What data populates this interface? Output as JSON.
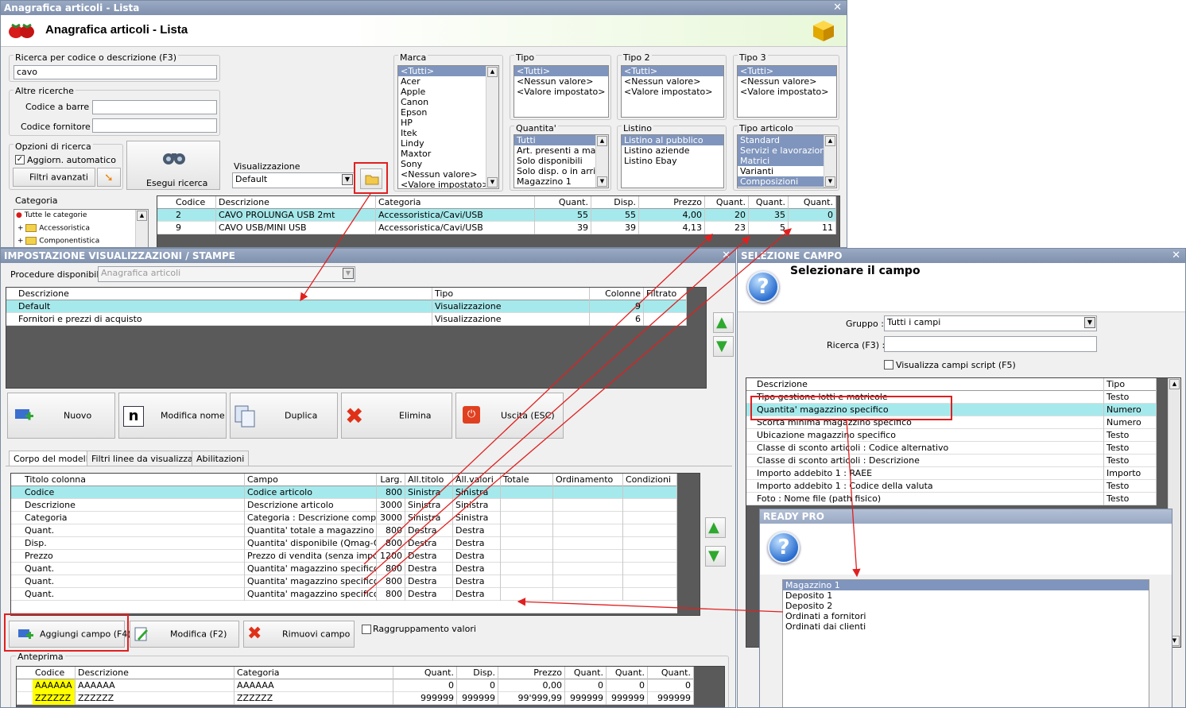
{
  "main_window": {
    "title": "Anagrafica articoli  - Lista",
    "header_title": "Anagrafica articoli  - Lista",
    "search": {
      "label": "Ricerca per codice o descrizione (F3)",
      "value": "cavo"
    },
    "altre_ricerche": {
      "label": "Altre ricerche",
      "barcode_label": "Codice a barre :",
      "supplier_code_label": "Codice fornitore :"
    },
    "opzioni": {
      "label": "Opzioni di ricerca",
      "auto_update": "Aggiorn. automatico",
      "auto_update_checked": true,
      "advanced_filters": "Filtri avanzati"
    },
    "esegui": "Esegui ricerca",
    "visualizzazione": {
      "label": "Visualizzazione",
      "value": "Default"
    },
    "categoria": {
      "label": "Categoria",
      "items": [
        "Tutte le categorie",
        "Accessoristica",
        "Componentistica"
      ]
    },
    "marca": {
      "label": "Marca",
      "items": [
        "<Tutti>",
        "Acer",
        "Apple",
        "Canon",
        "Epson",
        "HP",
        "Itek",
        "Lindy",
        "Maxtor",
        "Sony",
        "<Nessun valore>",
        "<Valore impostato>"
      ]
    },
    "tipo": {
      "label": "Tipo",
      "items": [
        "<Tutti>",
        "<Nessun valore>",
        "<Valore impostato>"
      ]
    },
    "tipo2": {
      "label": "Tipo 2",
      "items": [
        "<Tutti>",
        "<Nessun valore>",
        "<Valore impostato>"
      ]
    },
    "tipo3": {
      "label": "Tipo 3",
      "items": [
        "<Tutti>",
        "<Nessun valore>",
        "<Valore impostato>"
      ]
    },
    "quantita": {
      "label": "Quantita'",
      "items": [
        "Tutti",
        "Art. presenti a magazzino",
        "Solo disponibili",
        "Solo disp. o in arrivo",
        "Magazzino 1"
      ]
    },
    "listino": {
      "label": "Listino",
      "items": [
        "Listino al pubblico",
        "Listino aziende",
        "Listino Ebay"
      ]
    },
    "tipo_articolo": {
      "label": "Tipo articolo",
      "items": [
        "Standard",
        "Servizi e lavorazioni",
        "Matrici",
        "Varianti",
        "Composizioni"
      ]
    },
    "grid": {
      "headers": [
        "Codice",
        "Descrizione",
        "Categoria",
        "Quant.",
        "Disp.",
        "Prezzo",
        "Quant.",
        "Quant.",
        "Quant."
      ],
      "rows": [
        [
          "2",
          "CAVO PROLUNGA USB 2mt",
          "Accessoristica/Cavi/USB",
          "55",
          "55",
          "4,00",
          "20",
          "35",
          "0"
        ],
        [
          "9",
          "CAVO USB/MINI USB",
          "Accessoristica/Cavi/USB",
          "39",
          "39",
          "4,13",
          "23",
          "5",
          "11"
        ]
      ]
    }
  },
  "settings_window": {
    "title": "IMPOSTAZIONE VISUALIZZAZIONI / STAMPE",
    "procedure": {
      "label": "Procedure disponibili :",
      "value": "Anagrafica articoli"
    },
    "views_grid": {
      "headers": [
        "Descrizione",
        "Tipo",
        "Colonne",
        "Filtrato"
      ],
      "rows": [
        [
          "Default",
          "Visualizzazione",
          "9",
          ""
        ],
        [
          "Fornitori e prezzi di acquisto",
          "Visualizzazione",
          "6",
          ""
        ]
      ]
    },
    "buttons": {
      "nuovo": "Nuovo",
      "modifica_nome": "Modifica nome",
      "duplica": "Duplica",
      "elimina": "Elimina",
      "uscita": "Uscita (ESC)"
    },
    "tabs": [
      "Corpo del modello",
      "Filtri linee da visualizzare",
      "Abilitazioni"
    ],
    "columns_grid": {
      "headers": [
        "Titolo colonna",
        "Campo",
        "Larg.",
        "All.titolo",
        "All.valori",
        "Totale",
        "Ordinamento",
        "Condizioni"
      ],
      "rows": [
        [
          "Codice",
          "Codice articolo",
          "800",
          "Sinistra",
          "Sinistra"
        ],
        [
          "Descrizione",
          "Descrizione articolo",
          "3000",
          "Sinistra",
          "Sinistra"
        ],
        [
          "Categoria",
          "Categoria : Descrizione comple...",
          "3000",
          "Sinistra",
          "Sinistra"
        ],
        [
          "Quant.",
          "Quantita' totale a magazzino",
          "800",
          "Destra",
          "Destra"
        ],
        [
          "Disp.",
          "Quantita' disponibile (Qmag-Qo...",
          "800",
          "Destra",
          "Destra"
        ],
        [
          "Prezzo",
          "Prezzo di vendita (senza imposte)",
          "1200",
          "Destra",
          "Destra"
        ],
        [
          "Quant.",
          "Quantita' magazzino specifico",
          "800",
          "Destra",
          "Destra"
        ],
        [
          "Quant.",
          "Quantita' magazzino specifico",
          "800",
          "Destra",
          "Destra"
        ],
        [
          "Quant.",
          "Quantita' magazzino specifico",
          "800",
          "Destra",
          "Destra"
        ]
      ]
    },
    "bottom_buttons": {
      "aggiungi": "Aggiungi campo (F4)",
      "modifica": "Modifica (F2)",
      "rimuovi": "Rimuovi campo",
      "raggruppamento": "Raggruppamento valori"
    },
    "anteprima": {
      "label": "Anteprima",
      "headers": [
        "Codice",
        "Descrizione",
        "Categoria",
        "Quant.",
        "Disp.",
        "Prezzo",
        "Quant.",
        "Quant.",
        "Quant."
      ],
      "rows": [
        [
          "AAAAAA",
          "AAAAAA",
          "AAAAAA",
          "0",
          "0",
          "0,00",
          "0",
          "0",
          "0"
        ],
        [
          "ZZZZZZ",
          "ZZZZZZ",
          "ZZZZZZ",
          "999999",
          "999999",
          "99'999,99",
          "999999",
          "999999",
          "999999"
        ]
      ]
    }
  },
  "field_window": {
    "title": "SELEZIONE CAMPO",
    "heading": "Selezionare il campo",
    "gruppo": {
      "label": "Gruppo :",
      "value": "Tutti i campi"
    },
    "ricerca_label": "Ricerca (F3) :",
    "script_fields": "Visualizza campi script (F5)",
    "grid": {
      "headers": [
        "Descrizione",
        "Tipo"
      ],
      "rows": [
        [
          "Tipo gestione lotti e matricole",
          "Testo"
        ],
        [
          "Quantita' magazzino specifico",
          "Numero"
        ],
        [
          "Scorta minima magazzino specifico",
          "Numero"
        ],
        [
          "Ubicazione magazzino specifico",
          "Testo"
        ],
        [
          "Classe di sconto articoli : Codice alternativo",
          "Testo"
        ],
        [
          "Classe di sconto articoli : Descrizione",
          "Testo"
        ],
        [
          "Importo addebito 1 : RAEE",
          "Importo"
        ],
        [
          "Importo addebito 1 : Codice della valuta",
          "Testo"
        ],
        [
          "Foto : Nome file (path fisico)",
          "Testo"
        ]
      ]
    }
  },
  "ready_pro_dialog": {
    "title": "READY PRO",
    "items": [
      "Magazzino 1",
      "Deposito 1",
      "Deposito 2",
      "Ordinati a fornitori",
      "Ordinati dai clienti"
    ]
  },
  "colors": {
    "accent_select": "#7f95bd",
    "row_highlight": "#a6e9ec",
    "annotation_red": "#e02020",
    "preview_yellow": "#ffff00"
  }
}
